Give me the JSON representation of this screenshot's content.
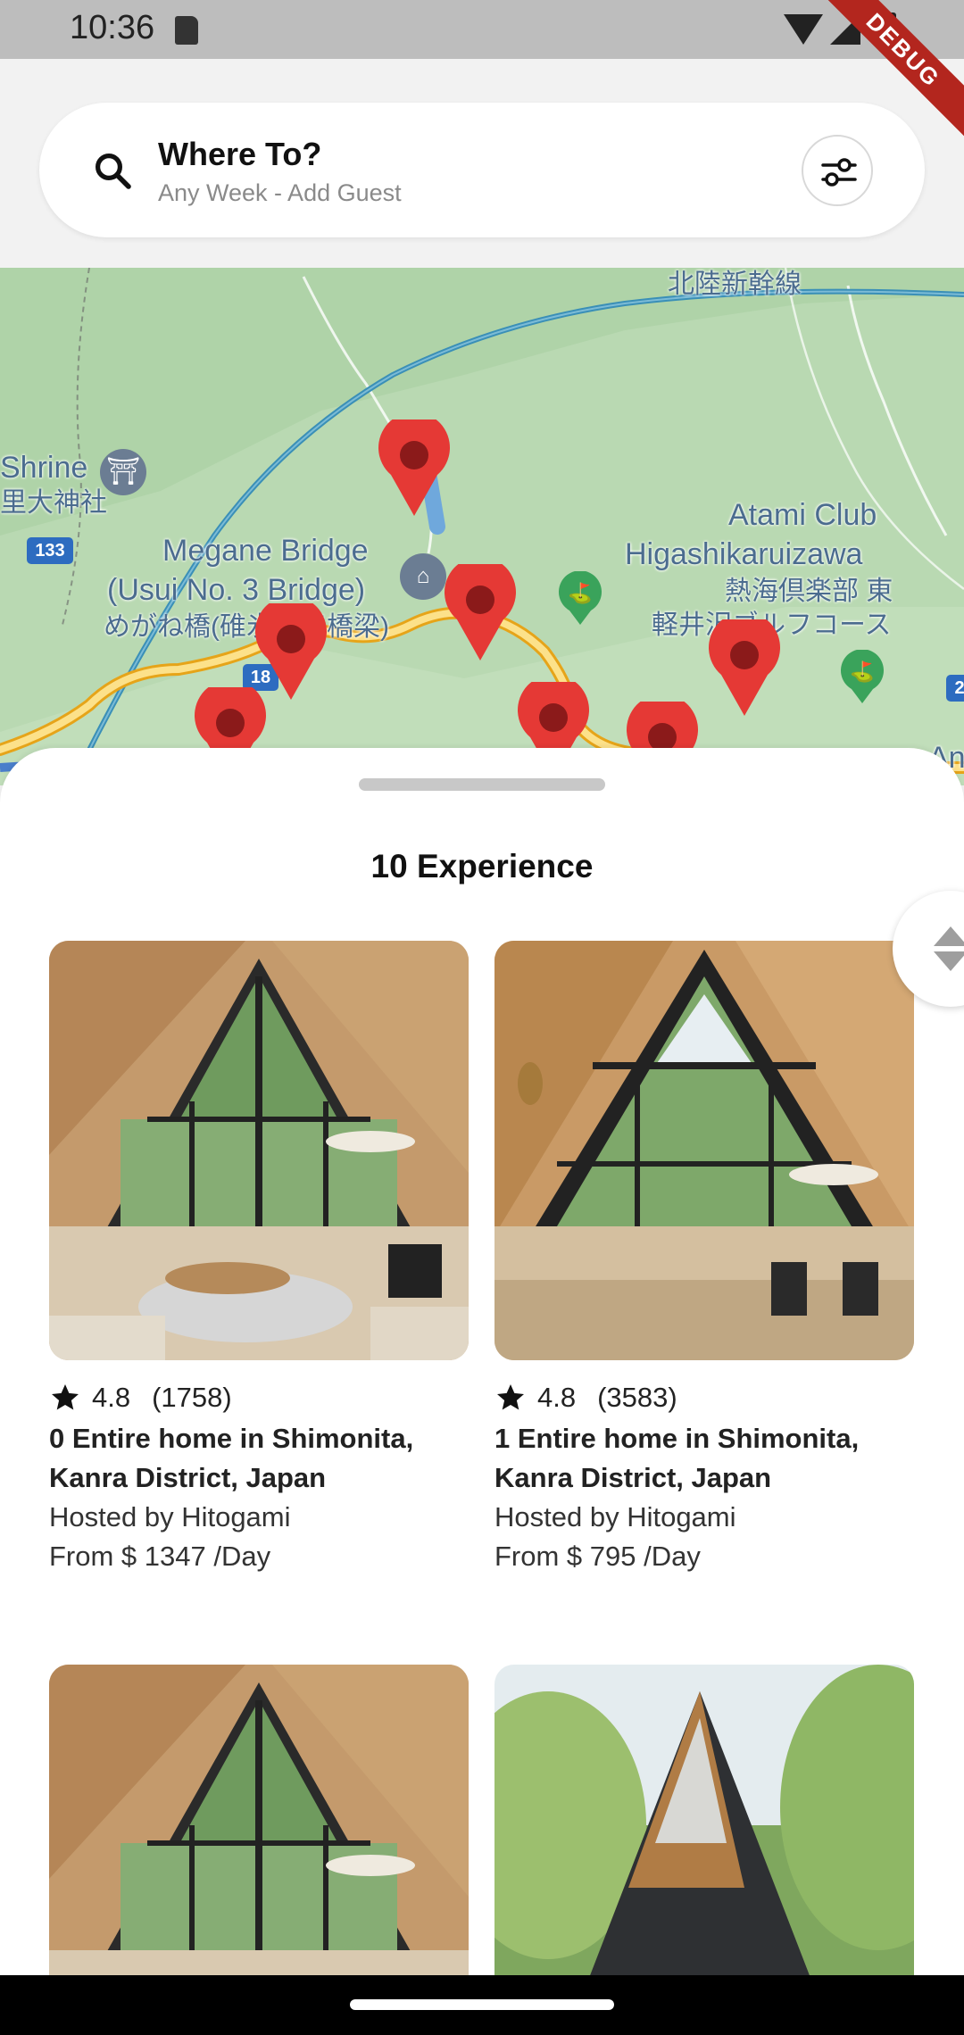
{
  "status_bar": {
    "time": "10:36",
    "debug_label": "DEBUG"
  },
  "search": {
    "title": "Where To?",
    "subtitle": "Any Week - Add Guest"
  },
  "map": {
    "labels": {
      "rail": "北陸新幹線",
      "shrine_en": "Shrine",
      "shrine_jp": "里大神社",
      "bridge_line1": "Megane Bridge",
      "bridge_line2": "(Usui No. 3 Bridge)",
      "bridge_jp": "めがね橋(碓氷第三橋梁)",
      "club_line1": "Atami Club",
      "club_line2": "Higashikaruizawa",
      "club_jp1": "熱海倶楽部 東",
      "club_jp2": "軽井沢ゴルフコース",
      "edge": "An"
    },
    "road_shields": [
      "133",
      "18",
      "2"
    ],
    "marker_color": "#e53935"
  },
  "sheet": {
    "title": "10 Experience"
  },
  "listings": [
    {
      "rating": "4.8",
      "reviews": "(1758)",
      "title": "0 Entire home in Shimonita, Kanra District, Japan",
      "host": "Hosted by Hitogami",
      "price": "From $ 1347  /Day"
    },
    {
      "rating": "4.8",
      "reviews": "(3583)",
      "title": "1 Entire home in Shimonita, Kanra District, Japan",
      "host": "Hosted by Hitogami",
      "price": "From $ 795  /Day"
    }
  ],
  "colors": {
    "accent_marker": "#e53935",
    "map_green": "#b9d9b2",
    "route": "#f5c242"
  }
}
